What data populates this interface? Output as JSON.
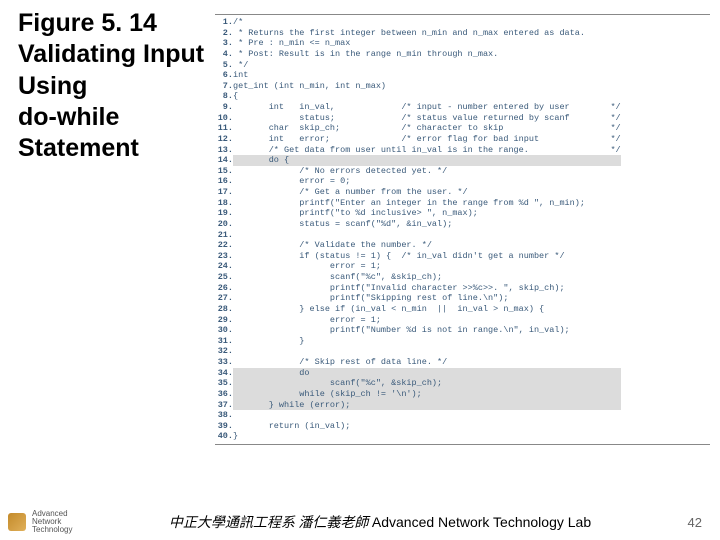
{
  "title_lines": [
    "Figure 5. 14",
    "Validating Input",
    "Using",
    "do-while",
    "Statement"
  ],
  "code_lines": [
    {
      "n": "1.",
      "t": "/*"
    },
    {
      "n": "2.",
      "t": " * Returns the first integer between n_min and n_max entered as data."
    },
    {
      "n": "3.",
      "t": " * Pre : n_min <= n_max"
    },
    {
      "n": "4.",
      "t": " * Post: Result is in the range n_min through n_max."
    },
    {
      "n": "5.",
      "t": " */"
    },
    {
      "n": "6.",
      "t": "int"
    },
    {
      "n": "7.",
      "t": "get_int (int n_min, int n_max)"
    },
    {
      "n": "8.",
      "t": "{"
    },
    {
      "n": "9.",
      "t": "       int   in_val,             /* input - number entered by user        */"
    },
    {
      "n": "10.",
      "t": "             status;             /* status value returned by scanf        */"
    },
    {
      "n": "11.",
      "t": "       char  skip_ch;            /* character to skip                     */"
    },
    {
      "n": "12.",
      "t": "       int   error;              /* error flag for bad input              */"
    },
    {
      "n": "13.",
      "t": "       /* Get data from user until in_val is in the range.                */"
    },
    {
      "n": "14.",
      "t": "       do {",
      "hl": true
    },
    {
      "n": "15.",
      "t": "             /* No errors detected yet. */"
    },
    {
      "n": "16.",
      "t": "             error = 0;"
    },
    {
      "n": "17.",
      "t": "             /* Get a number from the user. */"
    },
    {
      "n": "18.",
      "t": "             printf(\"Enter an integer in the range from %d \", n_min);"
    },
    {
      "n": "19.",
      "t": "             printf(\"to %d inclusive> \", n_max);"
    },
    {
      "n": "20.",
      "t": "             status = scanf(\"%d\", &in_val);"
    },
    {
      "n": "21.",
      "t": ""
    },
    {
      "n": "22.",
      "t": "             /* Validate the number. */"
    },
    {
      "n": "23.",
      "t": "             if (status != 1) {  /* in_val didn't get a number */"
    },
    {
      "n": "24.",
      "t": "                   error = 1;"
    },
    {
      "n": "25.",
      "t": "                   scanf(\"%c\", &skip_ch);"
    },
    {
      "n": "26.",
      "t": "                   printf(\"Invalid character >>%c>>. \", skip_ch);"
    },
    {
      "n": "27.",
      "t": "                   printf(\"Skipping rest of line.\\n\");"
    },
    {
      "n": "28.",
      "t": "             } else if (in_val < n_min  ||  in_val > n_max) {"
    },
    {
      "n": "29.",
      "t": "                   error = 1;"
    },
    {
      "n": "30.",
      "t": "                   printf(\"Number %d is not in range.\\n\", in_val);"
    },
    {
      "n": "31.",
      "t": "             }"
    },
    {
      "n": "32.",
      "t": ""
    },
    {
      "n": "33.",
      "t": "             /* Skip rest of data line. */"
    },
    {
      "n": "34.",
      "t": "             do",
      "hl": true
    },
    {
      "n": "35.",
      "t": "                   scanf(\"%c\", &skip_ch);",
      "hl": true
    },
    {
      "n": "36.",
      "t": "             while (skip_ch != '\\n');",
      "hl": true
    },
    {
      "n": "37.",
      "t": "       } while (error);",
      "hl": true
    },
    {
      "n": "38.",
      "t": ""
    },
    {
      "n": "39.",
      "t": "       return (in_val);"
    },
    {
      "n": "40.",
      "t": "}"
    }
  ],
  "footer": {
    "logo_text_lines": [
      "Advanced",
      "Network",
      "Technology"
    ],
    "center_chinese": "中正大學通訊工程系 潘仁義老師",
    "center_english": "Advanced Network Technology Lab",
    "page": "42"
  }
}
